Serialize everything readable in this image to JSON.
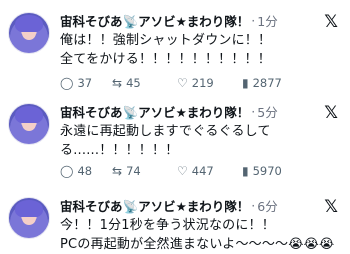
{
  "tweets": [
    {
      "name": "宙科そびあ📡アソビ★まわり隊！",
      "time": "1分",
      "lines": [
        "俺は！！強制シャットダウンに！！",
        "全てをかける！！！！！！！！！！"
      ],
      "replies": "37",
      "retweets": "45",
      "likes": "219",
      "views": "2877"
    },
    {
      "name": "宙科そびあ📡アソビ★まわり隊！",
      "time": "5分",
      "lines": [
        "永遠に再起動しますでぐるぐるして",
        "る......！！！！！！"
      ],
      "replies": "48",
      "retweets": "74",
      "likes": "447",
      "views": "5970"
    },
    {
      "name": "宙科そびあ📡アソビ★まわり隊！",
      "time": "6分",
      "lines": [
        "今！！1分1秒を争う状況なのに！！",
        "PCの再起動が全然進まないよ〜〜〜〜😭😭😭"
      ],
      "replies": "",
      "retweets": "",
      "likes": "",
      "views": ""
    }
  ],
  "icons": {
    "x_logo": "𝕏",
    "reply": "◯",
    "retweet": "⇆",
    "like": "♡",
    "views": "▮"
  }
}
